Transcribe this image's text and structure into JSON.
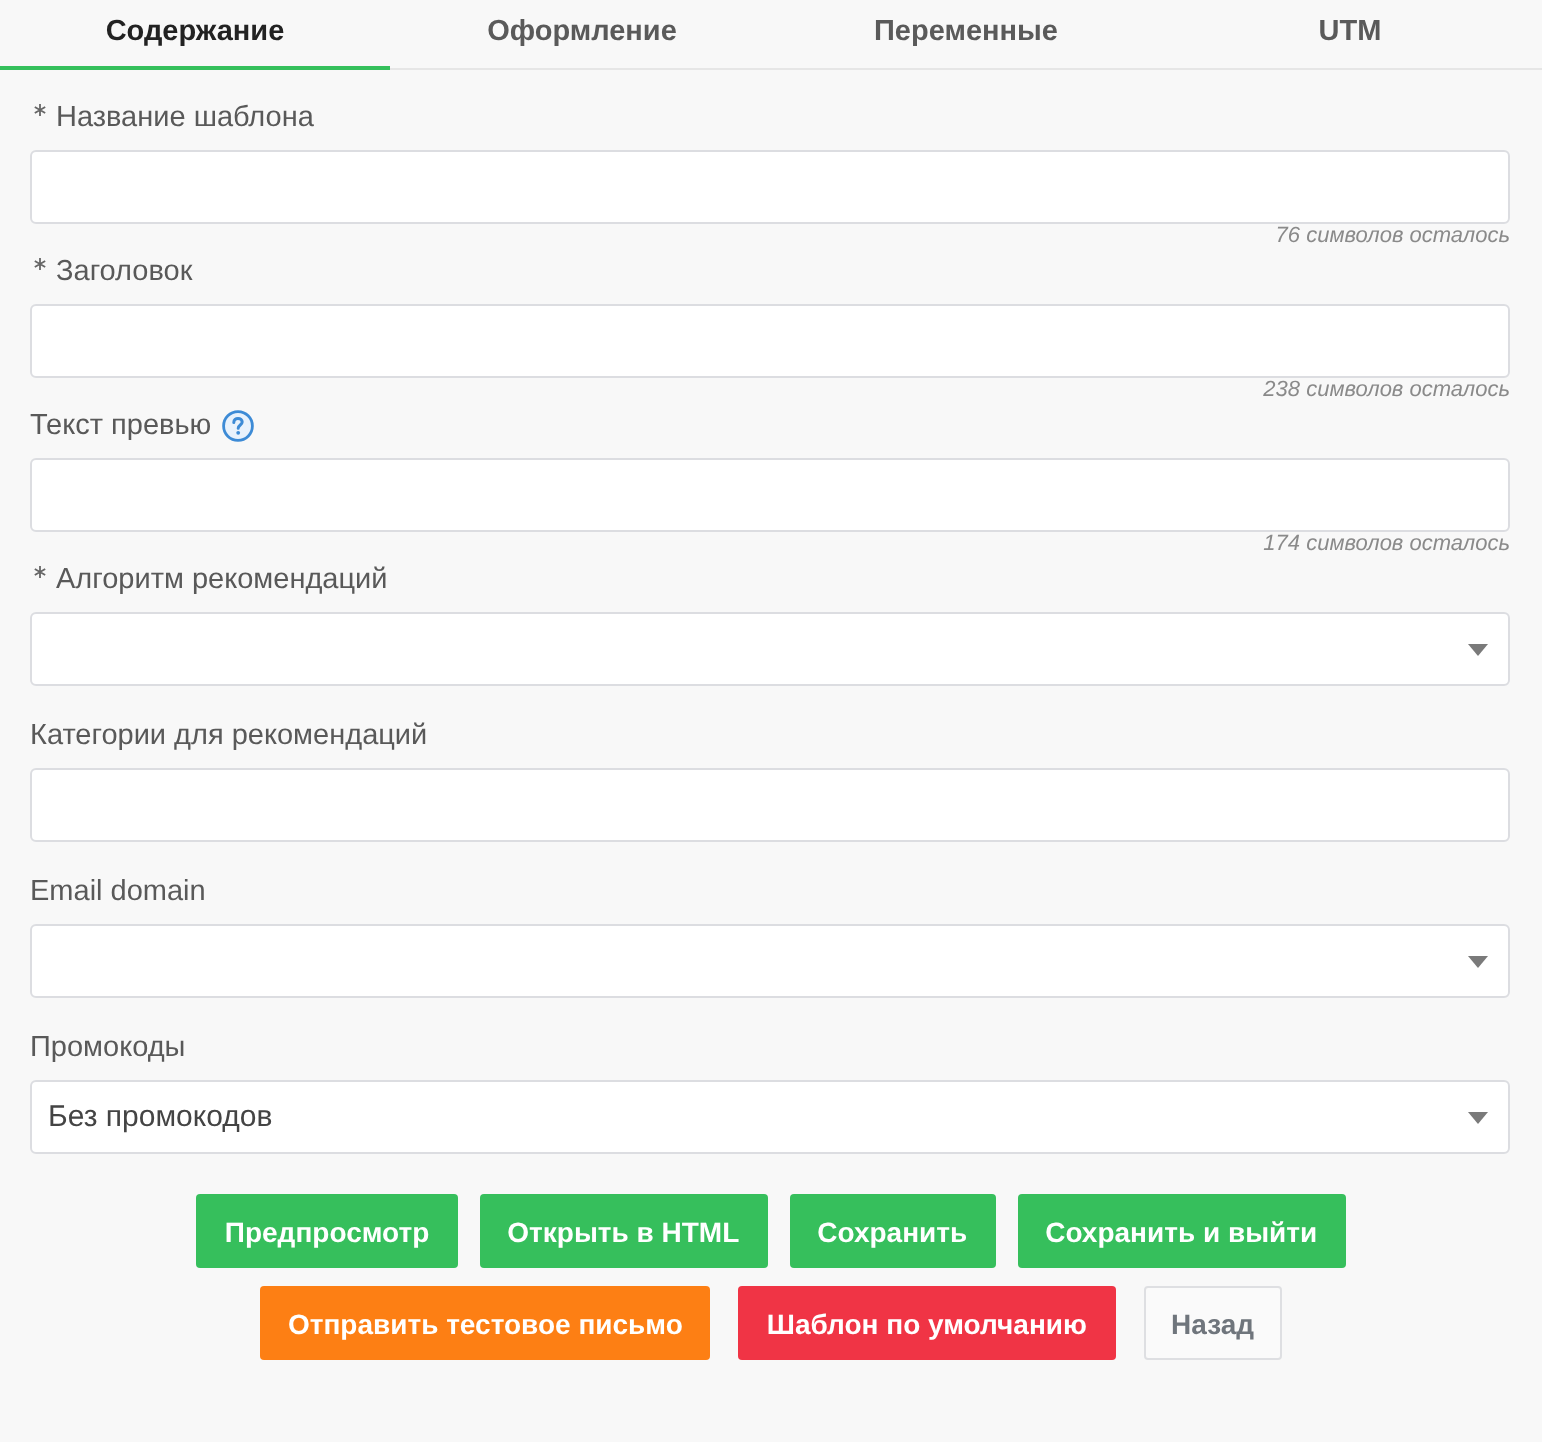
{
  "tabs": [
    {
      "label": "Содержание",
      "selected": true
    },
    {
      "label": "Оформление",
      "selected": false
    },
    {
      "label": "Переменные",
      "selected": false
    },
    {
      "label": "UTM",
      "selected": false
    }
  ],
  "fields": [
    {
      "kind": "text",
      "label": "Название шаблона",
      "required": true,
      "help": false,
      "counter": "76 символов осталось"
    },
    {
      "kind": "text",
      "label": "Заголовок",
      "required": true,
      "help": false,
      "counter": "238 символов осталось"
    },
    {
      "kind": "text",
      "label": "Текст превью",
      "required": false,
      "help": true,
      "counter": "174 символов осталось"
    },
    {
      "kind": "select",
      "label": "Алгоритм рекомендаций",
      "required": true,
      "help": false
    },
    {
      "kind": "text",
      "label": "Категории для рекомендаций",
      "required": false,
      "help": false
    },
    {
      "kind": "select",
      "label": "Email domain",
      "required": false,
      "help": false
    },
    {
      "kind": "select",
      "label": "Промокоды",
      "required": false,
      "help": false,
      "value": "Без промокодов"
    }
  ],
  "button_rows": [
    {
      "buttons": [
        {
          "label": "Предпросмотр",
          "kind": "success"
        },
        {
          "label": "Открыть в HTML",
          "kind": "success"
        },
        {
          "label": "Сохранить",
          "kind": "success"
        },
        {
          "label": "Сохранить и выйти",
          "kind": "success"
        }
      ]
    },
    {
      "buttons": [
        {
          "label": "Отправить тестовое письмо",
          "kind": "warning"
        },
        {
          "label": "Шаблон по умолчанию",
          "kind": "danger"
        },
        {
          "label": "Назад",
          "kind": "default"
        }
      ]
    }
  ]
}
